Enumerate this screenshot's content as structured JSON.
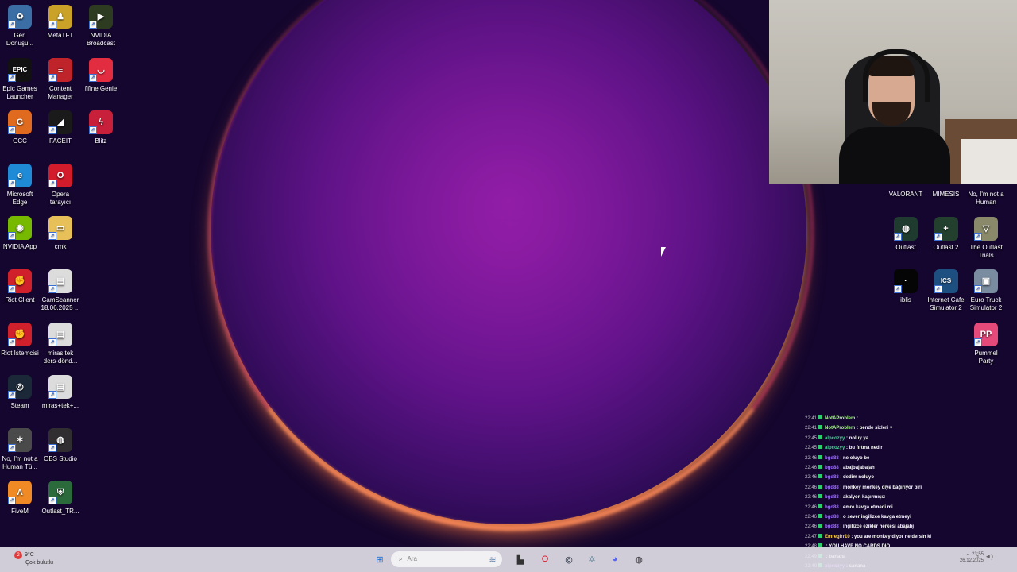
{
  "desktop_left": [
    {
      "label": "Geri Dönüşü...",
      "icon": "recycle-bin-icon",
      "color": "#3a6ea5",
      "glyph": "♻"
    },
    {
      "label": "MetaTFT",
      "icon": "metatft-icon",
      "color": "#c9a227",
      "glyph": "♟"
    },
    {
      "label": "NVIDIA Broadcast",
      "icon": "nvidia-broadcast-icon",
      "color": "#2d3b20",
      "glyph": "▶"
    },
    {
      "label": "Epic Games Launcher",
      "icon": "epic-games-icon",
      "color": "#111111",
      "glyph": "EPIC"
    },
    {
      "label": "Content Manager",
      "icon": "content-manager-icon",
      "color": "#c0242b",
      "glyph": "≡"
    },
    {
      "label": "fifine Genie",
      "icon": "fifine-genie-icon",
      "color": "#e22c3f",
      "glyph": "◡"
    },
    {
      "label": "GCC",
      "icon": "gcc-icon",
      "color": "#e06b1f",
      "glyph": "G"
    },
    {
      "label": "FACEIT",
      "icon": "faceit-icon",
      "color": "#1a1a1a",
      "glyph": "◢"
    },
    {
      "label": "Blitz",
      "icon": "blitz-icon",
      "color": "#c81f3a",
      "glyph": "ϟ"
    },
    {
      "label": "Microsoft Edge",
      "icon": "edge-icon",
      "color": "#1f8ad6",
      "glyph": "e"
    },
    {
      "label": "Opera tarayıcı",
      "icon": "opera-icon",
      "color": "#d21b2b",
      "glyph": "O"
    },
    {
      "label": "NVIDIA App",
      "icon": "nvidia-app-icon",
      "color": "#76b900",
      "glyph": "◉"
    },
    {
      "label": "cmk",
      "icon": "folder-icon",
      "color": "#e8c05a",
      "glyph": "▭"
    },
    {
      "label": "Riot Client",
      "icon": "riot-client-icon",
      "color": "#d0202b",
      "glyph": "✊"
    },
    {
      "label": "CamScanner 18.06.2025 ...",
      "icon": "document-icon",
      "color": "#dcdcdc",
      "glyph": "▤"
    },
    {
      "label": "Riot İstemcisi",
      "icon": "riot-client-icon",
      "color": "#d0202b",
      "glyph": "✊"
    },
    {
      "label": "miras tek ders-dönd...",
      "icon": "document-icon",
      "color": "#dcdcdc",
      "glyph": "▤"
    },
    {
      "label": "Steam",
      "icon": "steam-icon",
      "color": "#1b2838",
      "glyph": "◎"
    },
    {
      "label": "miras+tek+...",
      "icon": "document-icon",
      "color": "#dcdcdc",
      "glyph": "▤"
    },
    {
      "label": "No, I'm not a Human Tü...",
      "icon": "no-im-not-a-human-icon",
      "color": "#4a4a4a",
      "glyph": "✶"
    },
    {
      "label": "OBS Studio",
      "icon": "obs-studio-icon",
      "color": "#302e31",
      "glyph": "◍"
    },
    {
      "label": "FiveM",
      "icon": "fivem-icon",
      "color": "#f08a24",
      "glyph": "Λ"
    },
    {
      "label": "Outlast_TR...",
      "icon": "outlast-tr-icon",
      "color": "#2b6a3a",
      "glyph": "⛨"
    }
  ],
  "desktop_right": [
    {
      "label": "VALORANT",
      "icon": "valorant-icon",
      "color": "#bd3944",
      "glyph": ""
    },
    {
      "label": "MIMESIS",
      "icon": "mimesis-icon",
      "color": "#4b2a2a",
      "glyph": ""
    },
    {
      "label": "No, I'm not a Human",
      "icon": "no-im-not-a-human-icon",
      "color": "#555555",
      "glyph": ""
    },
    {
      "label": "Outlast",
      "icon": "outlast-icon",
      "color": "#1f3b30",
      "glyph": "◍"
    },
    {
      "label": "Outlast 2",
      "icon": "outlast-2-icon",
      "color": "#23402e",
      "glyph": "+"
    },
    {
      "label": "The Outlast Trials",
      "icon": "outlast-trials-icon",
      "color": "#8a8a6a",
      "glyph": "▽"
    },
    {
      "label": "iblis",
      "icon": "iblis-icon",
      "color": "#050505",
      "glyph": "·"
    },
    {
      "label": "Internet Cafe Simulator 2",
      "icon": "internet-cafe-icon",
      "color": "#1d4f80",
      "glyph": "ICS"
    },
    {
      "label": "Euro Truck Simulator 2",
      "icon": "euro-truck-icon",
      "color": "#7a8ca0",
      "glyph": "▣"
    },
    {
      "label": "Pummel Party",
      "icon": "pummel-party-icon",
      "color": "#e64a7a",
      "glyph": "PP"
    }
  ],
  "chat": [
    {
      "time": "22:41",
      "user": "NotAProblem",
      "user_color": "#a0ff7a",
      "msg": ":"
    },
    {
      "time": "22:41",
      "user": "NotAProblem",
      "user_color": "#a0ff7a",
      "msg": ": bende sizleri ♥"
    },
    {
      "time": "22:45",
      "user": "alpcozyy",
      "user_color": "#40d090",
      "msg": ": noluy ya"
    },
    {
      "time": "22:45",
      "user": "alpcozyy",
      "user_color": "#40d090",
      "msg": ": bu fırtına nedir"
    },
    {
      "time": "22:46",
      "user": "bgd88",
      "user_color": "#a070ff",
      "msg": ": ne oluyo be"
    },
    {
      "time": "22:46",
      "user": "bgd88",
      "user_color": "#a070ff",
      "msg": ": abajbajabajah"
    },
    {
      "time": "22:46",
      "user": "bgd88",
      "user_color": "#a070ff",
      "msg": ": dedim noluyo"
    },
    {
      "time": "22:46",
      "user": "bgd88",
      "user_color": "#a070ff",
      "msg": ": monkey monkey diye bağırıyor biri"
    },
    {
      "time": "22:46",
      "user": "bgd88",
      "user_color": "#a070ff",
      "msg": ": akalyon kaçırmışız"
    },
    {
      "time": "22:46",
      "user": "bgd88",
      "user_color": "#a070ff",
      "msg": ": emre kavga etmedi mi"
    },
    {
      "time": "22:46",
      "user": "bgd88",
      "user_color": "#a070ff",
      "msg": ": o sever ingilizce kavga etmeyi"
    },
    {
      "time": "22:46",
      "user": "bgd88",
      "user_color": "#a070ff",
      "msg": ": ingilizce ezikler herkesi abajabj"
    },
    {
      "time": "22:47",
      "user": "Emreglrr10",
      "user_color": "#ffd34a",
      "msg": ": you are monkey diyor ne dersin ki"
    },
    {
      "time": "22:48",
      "user": "",
      "user_color": "#ff5050",
      "msg": ": YOU HAVE NO CARDS DIO"
    },
    {
      "time": "22:49",
      "user": "",
      "user_color": "#a070ff",
      "msg": ": banana"
    },
    {
      "time": "22:49",
      "user": "alpcozyy",
      "user_color": "#a070ff",
      "msg": ": sanana"
    }
  ],
  "taskbar": {
    "weather_temp": "9°C",
    "weather_desc": "Çok bulutlu",
    "weather_badge": "2",
    "search_placeholder": "Ara",
    "clock_time": "23:55",
    "clock_date": "26.12.2025",
    "apps": [
      {
        "name": "start-button-icon",
        "glyph": "⊞",
        "color": "#1f6fd1"
      },
      {
        "name": "copilot-icon",
        "glyph": "≋",
        "color": "#5a7fa8"
      },
      {
        "name": "file-explorer-icon",
        "glyph": "▙",
        "color": "#333333"
      },
      {
        "name": "opera-taskbar-icon",
        "glyph": "O",
        "color": "#d21b2b"
      },
      {
        "name": "steam-taskbar-icon",
        "glyph": "◎",
        "color": "#1b2838"
      },
      {
        "name": "nvidia-taskbar-icon",
        "glyph": "✲",
        "color": "#6b8a9a"
      },
      {
        "name": "discord-taskbar-icon",
        "glyph": "◕",
        "color": "#5865f2"
      },
      {
        "name": "obs-taskbar-icon",
        "glyph": "◍",
        "color": "#302e31"
      }
    ]
  }
}
